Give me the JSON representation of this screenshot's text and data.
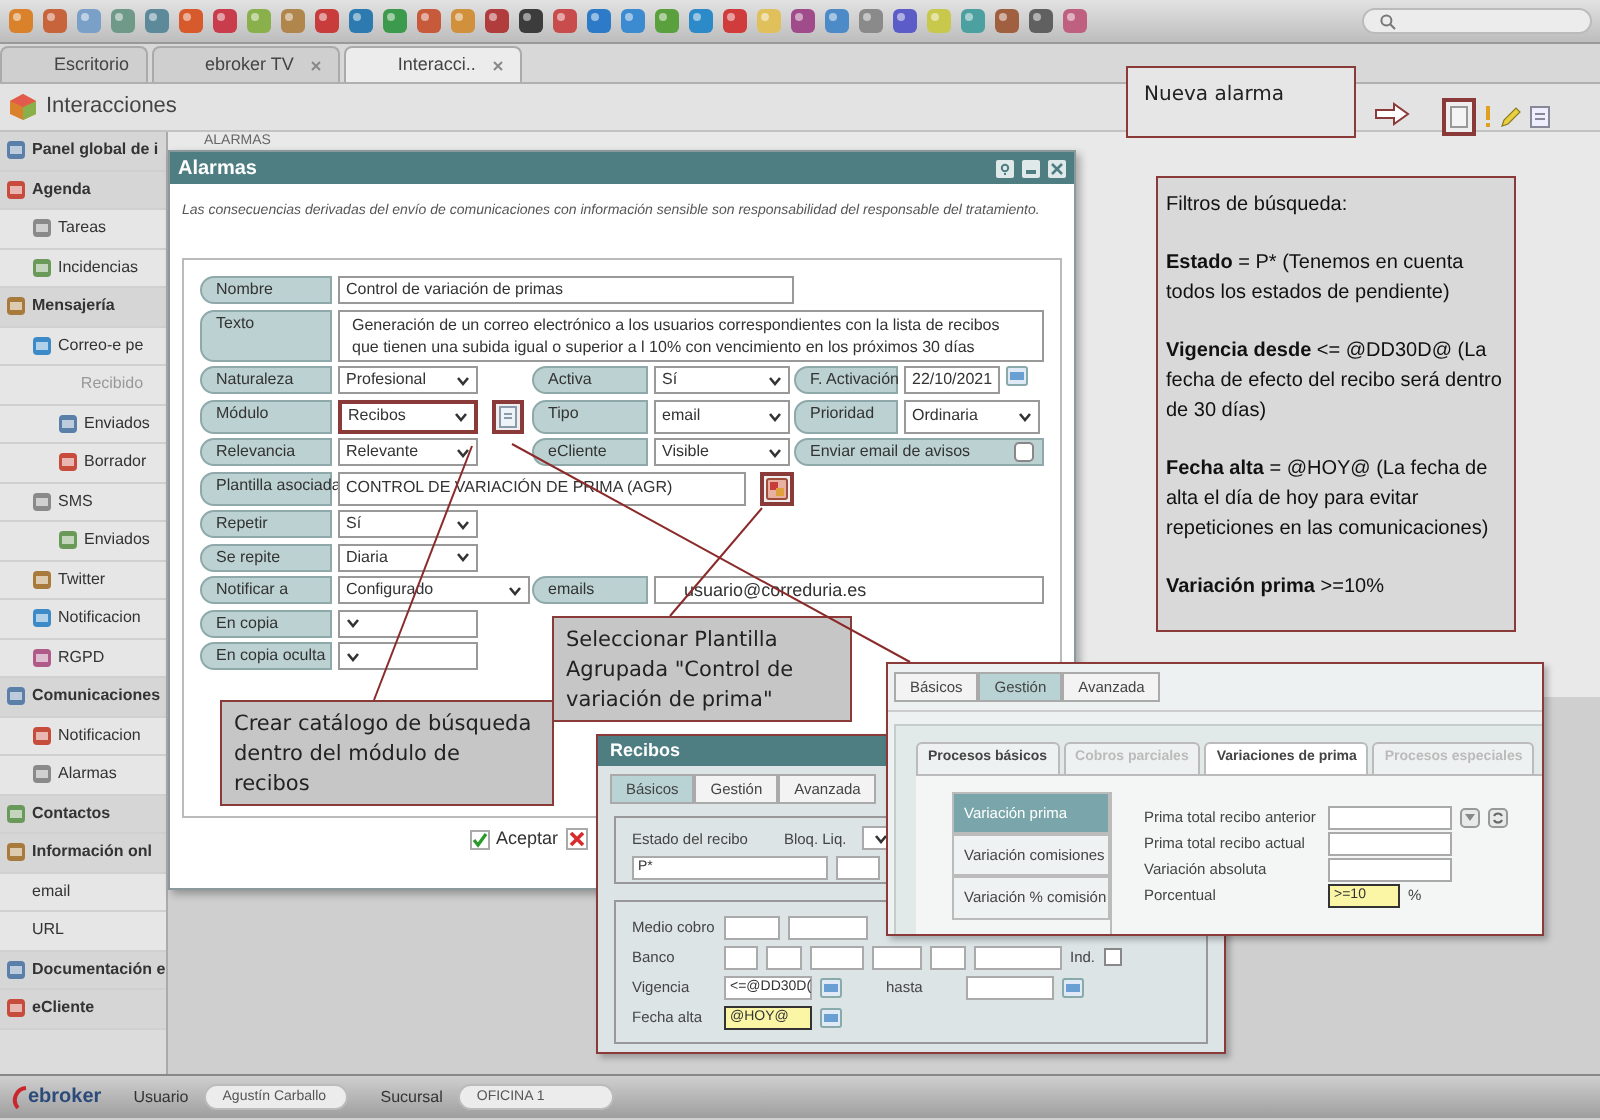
{
  "tabs": [
    {
      "label": "Escritorio",
      "selected": false,
      "closable": false
    },
    {
      "label": "ebroker TV",
      "selected": false,
      "closable": true
    },
    {
      "label": "Interacci..",
      "selected": true,
      "closable": true
    }
  ],
  "header": {
    "title": "Interacciones"
  },
  "sidebar": {
    "items": [
      {
        "label": "Panel global de i",
        "icon": true,
        "selected": false
      },
      {
        "label": "Agenda",
        "icon": true,
        "selected": false,
        "children": [
          {
            "label": "Tareas",
            "icon": true,
            "selected": false
          },
          {
            "label": "Incidencias",
            "icon": true,
            "selected": false
          }
        ]
      },
      {
        "label": "Mensajería",
        "icon": true,
        "selected": false,
        "children": [
          {
            "label": "Correo-e pe",
            "icon": true,
            "selected": false,
            "children": [
              {
                "label": "Recibido",
                "icon": false,
                "selected": true
              },
              {
                "label": "Enviados",
                "icon": true,
                "selected": false
              },
              {
                "label": "Borrador",
                "icon": true,
                "selected": false
              }
            ]
          },
          {
            "label": "SMS",
            "icon": true,
            "selected": false,
            "children": [
              {
                "label": "Enviados",
                "icon": true,
                "selected": false
              }
            ]
          },
          {
            "label": "Twitter",
            "icon": true,
            "selected": false
          },
          {
            "label": "Notificacion",
            "icon": true,
            "selected": false
          },
          {
            "label": "RGPD",
            "icon": true,
            "selected": false
          }
        ]
      },
      {
        "label": "Comunicaciones",
        "icon": true,
        "selected": false,
        "children": [
          {
            "label": "Notificacion",
            "icon": true,
            "selected": false
          },
          {
            "label": "Alarmas",
            "icon": true,
            "selected": false
          }
        ]
      },
      {
        "label": "Contactos",
        "icon": true,
        "selected": false
      },
      {
        "label": "Información onl",
        "icon": true,
        "selected": false,
        "children": [
          {
            "label": "email",
            "icon": false,
            "selected": false
          },
          {
            "label": "URL",
            "icon": false,
            "selected": false
          }
        ]
      },
      {
        "label": "Documentación e",
        "icon": true,
        "selected": false
      },
      {
        "label": "eCliente",
        "icon": true,
        "selected": false
      }
    ]
  },
  "main": {
    "breadcrumb": "ALARMAS"
  },
  "dialog": {
    "title": "Alarmas",
    "notice": "Las consecuencias derivadas del envío de comunicaciones con información sensible son responsabilidad del responsable del tratamiento.",
    "ok_label": "Aceptar",
    "rows": [
      [
        {
          "label": "Nombre",
          "kind": "text",
          "value": "Control de variación de primas",
          "highlighted": false
        }
      ],
      [
        {
          "label": "Texto",
          "kind": "textarea",
          "value": "Generación de un correo electrónico a los usuarios correspondientes con la lista de recibos que tienen una subida igual o superior a l 10% con vencimiento en los próximos 30 días",
          "highlighted": false
        }
      ],
      [
        {
          "label": "Naturaleza",
          "kind": "select",
          "value": "Profesional",
          "highlighted": false
        },
        {
          "label": "Activa",
          "kind": "select",
          "value": "Sí",
          "highlighted": false
        },
        {
          "label": "F. Activación",
          "kind": "date",
          "value": "22/10/2021",
          "highlighted": false
        }
      ],
      [
        {
          "label": "Módulo",
          "kind": "select",
          "value": "Recibos",
          "highlighted": true,
          "action": {
            "kind": "catalog",
            "highlighted": true
          }
        },
        {
          "label": "Tipo",
          "kind": "select",
          "value": "email",
          "highlighted": false
        },
        {
          "label": "Prioridad",
          "kind": "select",
          "value": "Ordinaria",
          "highlighted": false
        }
      ],
      [
        {
          "label": "Relevancia",
          "kind": "select",
          "value": "Relevante",
          "highlighted": false
        },
        {
          "label": "eCliente",
          "kind": "select",
          "value": "Visible",
          "highlighted": false
        },
        {
          "label": "Enviar email de avisos",
          "kind": "checkbox",
          "checked": false
        }
      ],
      [
        {
          "label": "Plantilla asociada",
          "kind": "text",
          "value": "CONTROL DE VARIACIÓN DE PRIMA (AGR)",
          "highlighted": false,
          "action": {
            "kind": "template",
            "highlighted": true
          }
        }
      ],
      [
        {
          "label": "Repetir",
          "kind": "select",
          "value": "Sí",
          "highlighted": false
        }
      ],
      [
        {
          "label": "Se repite",
          "kind": "select",
          "value": "Diaria",
          "highlighted": false
        }
      ],
      [
        {
          "label": "Notificar a",
          "kind": "select",
          "value": "Configurado",
          "highlighted": false
        },
        {
          "label": "emails",
          "kind": "text",
          "value": "usuario@correduria.es",
          "highlighted": false
        }
      ],
      [
        {
          "label": "En copia",
          "kind": "select",
          "highlighted": false
        }
      ],
      [
        {
          "label": "En copia oculta",
          "kind": "select",
          "highlighted": false
        }
      ]
    ]
  },
  "annotations": {
    "new_alarm": "Nueva alarma",
    "filters": [
      "Filtros de búsqueda:",
      "**Estado** = P* (Tenemos en cuenta todos los estados de pendiente)",
      "**Vigencia desde** <= @DD30D@ (La fecha de efecto del recibo será dentro de 30 días)",
      "**Fecha alta** = @HOY@ (La fecha de alta el día de hoy para evitar repeticiones en las comunicaciones)",
      "**Variación prima** >=10%"
    ],
    "catalog_note": "Crear catálogo de búsqueda dentro del módulo de recibos",
    "template_note": "Seleccionar Plantilla Agrupada \"Control de variación de prima\""
  },
  "receipts_window": {
    "title": "Recibos",
    "tabs": [
      {
        "label": "Básicos",
        "selected": true
      },
      {
        "label": "Gestión",
        "selected": false
      },
      {
        "label": "Avanzada",
        "selected": false
      }
    ],
    "status_label": "Estado del recibo",
    "lock_label": "Bloq. Liq.",
    "status_value": "P*",
    "payment_label": "Medio cobro",
    "bank_label": "Banco",
    "ind_label": "Ind.",
    "ind_checked": false,
    "validity_label": "Vigencia",
    "validity_value": "<=@DD30D(",
    "until_label": "hasta",
    "created_label": "Fecha alta",
    "created_value": "@HOY@",
    "created_focused": true
  },
  "management_window": {
    "tabs": [
      {
        "label": "Básicos",
        "selected": false
      },
      {
        "label": "Gestión",
        "selected": true
      },
      {
        "label": "Avanzada",
        "selected": false
      }
    ],
    "subtabs": [
      {
        "label": "Procesos básicos",
        "selected": false,
        "disabled": false
      },
      {
        "label": "Cobros parciales",
        "selected": false,
        "disabled": true
      },
      {
        "label": "Variaciones de prima",
        "selected": true,
        "disabled": false
      },
      {
        "label": "Procesos especiales",
        "selected": false,
        "disabled": true
      }
    ],
    "menu": [
      {
        "label": "Variación prima",
        "selected": true
      },
      {
        "label": "Variación comisiones",
        "selected": false
      },
      {
        "label": "Variación % comisión",
        "selected": false
      }
    ],
    "fields": [
      {
        "label": "Prima total recibo anterior",
        "focused": false
      },
      {
        "label": "Prima total recibo actual",
        "focused": false
      },
      {
        "label": "Variación absoluta",
        "focused": false
      },
      {
        "label": "Porcentual",
        "value": ">=10",
        "unit": "%",
        "focused": true
      }
    ]
  },
  "status_bar": {
    "logo": "ebroker",
    "user_label": "Usuario",
    "user": "Agustín Carballo",
    "branch_label": "Sucursal",
    "branch": "OFICINA 1"
  }
}
